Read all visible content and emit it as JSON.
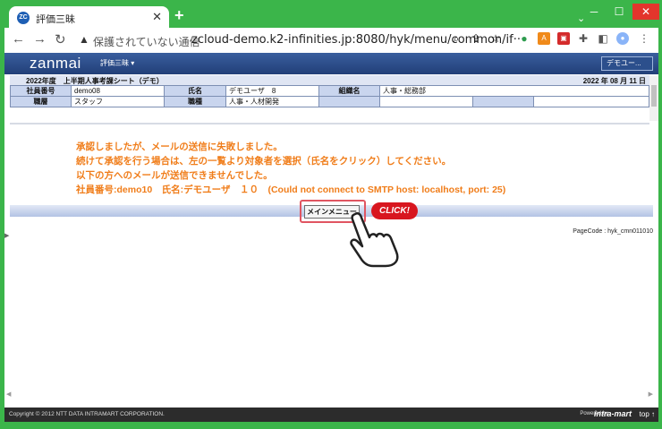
{
  "browser": {
    "tab_title": "評価三昧",
    "favicon_text": "ZC",
    "new_tab": "+",
    "close_tab": "✕",
    "security_label": "保護されていない通信",
    "url": "zcloud-demo.k2-infinities.jp:8080/hyk/menu/common/if···"
  },
  "app": {
    "logo": "zanmai",
    "menu": "評価三昧 ▾",
    "user": "デモユー..."
  },
  "sheet": {
    "title": "2022年度　上半期人事考課シート（デモ）",
    "date": "2022 年 08 月 11 日",
    "row1": {
      "emp_no_label": "社員番号",
      "emp_no": "demo08",
      "name_label": "氏名",
      "name": "デモユーザ　8",
      "org_label": "組織名",
      "org": "人事・総務部"
    },
    "row2": {
      "grade_label": "職層",
      "grade": "スタッフ",
      "role_label": "職種",
      "role": "人事・人材開発"
    }
  },
  "messages": {
    "line1": "承認しましたが、メールの送信に失敗しました。",
    "line2": "続けて承認を行う場合は、左の一覧より対象者を選択（氏名をクリック）してください。",
    "line3": "以下の方へのメールが送信できませんでした。",
    "line4": "社員番号:demo10　氏名:デモユーザ　１０　(Could not connect to SMTP host: localhost, port: 25)"
  },
  "main_menu_button": "メインメニュー",
  "click_label": "CLICK!",
  "page_code": "PageCode : hyk_cmn011010",
  "footer": {
    "copyright": "Copyright © 2012 NTT DATA INTRAMART CORPORATION.",
    "powered": "Powered by",
    "brand": "intra-mart",
    "top": "top ↑"
  },
  "colors": {
    "accent": "#3bb54a",
    "appbar": "#223f78",
    "message": "#f07d1a",
    "click": "#d8161f"
  }
}
